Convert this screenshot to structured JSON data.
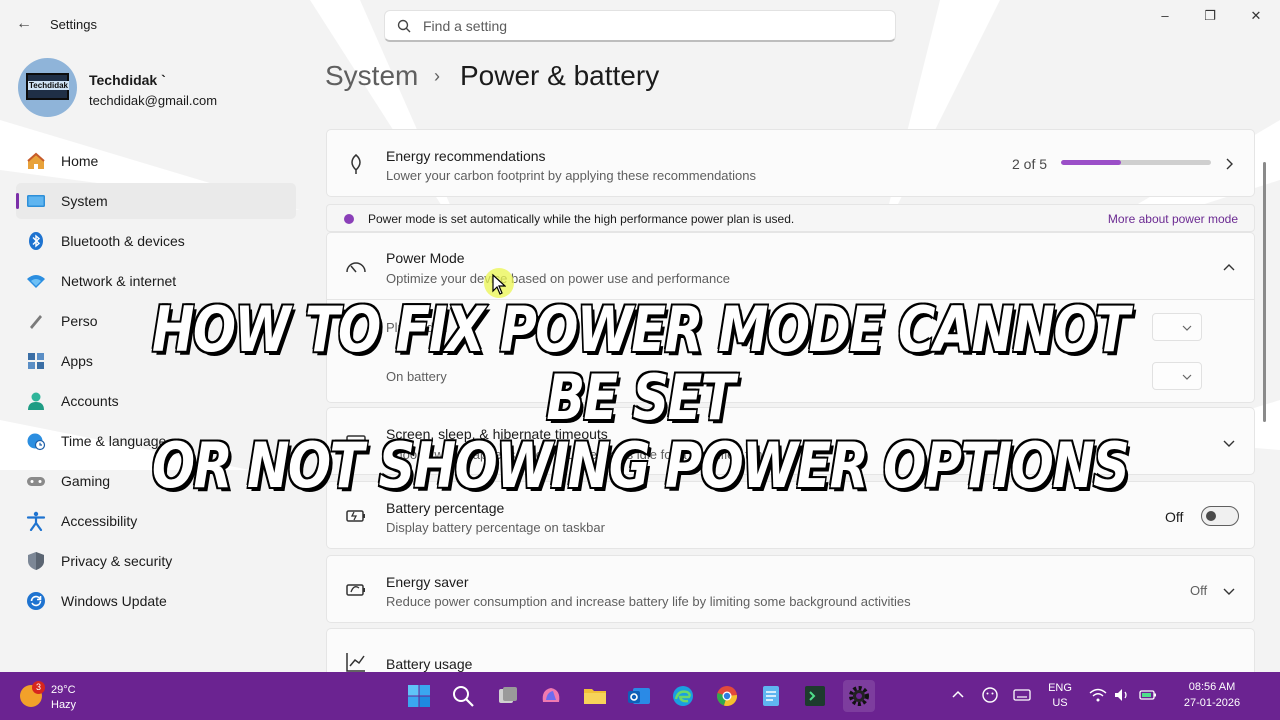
{
  "window": {
    "app_title": "Settings",
    "search_placeholder": "Find a setting",
    "controls": {
      "minimize": "–",
      "restore": "❐",
      "close": "✕"
    }
  },
  "profile": {
    "name": "Techdidak `",
    "email": "techdidak@gmail.com",
    "avatar_text": "Techdidak"
  },
  "nav": [
    {
      "label": "Home",
      "icon": "home-icon"
    },
    {
      "label": "System",
      "icon": "monitor-icon",
      "active": true
    },
    {
      "label": "Bluetooth & devices",
      "icon": "bluetooth-icon"
    },
    {
      "label": "Network & internet",
      "icon": "wifi-icon"
    },
    {
      "label": "Perso",
      "icon": "brush-icon"
    },
    {
      "label": "Apps",
      "icon": "apps-icon"
    },
    {
      "label": "Accounts",
      "icon": "person-icon"
    },
    {
      "label": "Time & language",
      "icon": "clock-globe-icon"
    },
    {
      "label": "Gaming",
      "icon": "gamepad-icon"
    },
    {
      "label": "Accessibility",
      "icon": "accessibility-icon"
    },
    {
      "label": "Privacy & security",
      "icon": "shield-icon"
    },
    {
      "label": "Windows Update",
      "icon": "update-icon"
    }
  ],
  "breadcrumb": {
    "parent": "System",
    "separator": "›",
    "current": "Power & battery"
  },
  "energy": {
    "title": "Energy recommendations",
    "desc": "Lower your carbon footprint by applying these recommendations",
    "progress_text": "2 of 5",
    "progress_fraction": 0.4
  },
  "info": {
    "text": "Power mode is set automatically while the high performance power plan is used.",
    "link": "More about power mode"
  },
  "power_mode": {
    "title": "Power Mode",
    "desc": "Optimize your device based on power use and performance",
    "sub1": "Plugged in",
    "sub2": "On battery"
  },
  "screen_sleep": {
    "title": "Screen, sleep, & hibernate timeouts",
    "desc": "Choose what happens when your device is idle for a specified time"
  },
  "battery_pct": {
    "title": "Battery percentage",
    "desc": "Display battery percentage on taskbar",
    "state": "Off"
  },
  "energy_saver": {
    "title": "Energy saver",
    "desc": "Reduce power consumption and increase battery life by limiting some background activities",
    "state": "Off"
  },
  "battery_usage": {
    "title": "Battery usage"
  },
  "headline": {
    "line1": "HOW TO FIX POWER MODE CANNOT BE SET",
    "line2": "OR NOT SHOWING POWER OPTIONS"
  },
  "taskbar": {
    "weather_badge": "3",
    "temp": "29°C",
    "condition": "Hazy",
    "lang_top": "ENG",
    "lang_bottom": "US",
    "time": "08:56 AM",
    "date": "27-01-2026"
  },
  "colors": {
    "accent": "#7b2fa8",
    "taskbar": "#6b2391",
    "progress_fill": "#9b4fc8"
  }
}
